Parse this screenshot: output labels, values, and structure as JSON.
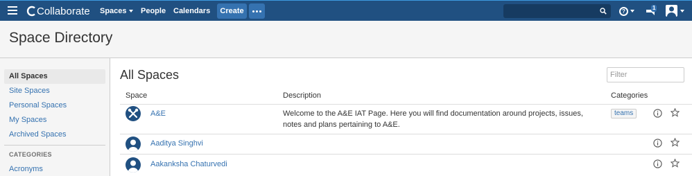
{
  "header": {
    "logo_text": "Collaborate",
    "nav": {
      "spaces": "Spaces",
      "people": "People",
      "calendars": "Calendars"
    },
    "create_label": "Create",
    "notification_count": "1",
    "icons": [
      "menu-icon",
      "logo-icon",
      "more-icon",
      "search-icon",
      "help-icon",
      "notification-icon",
      "user-avatar-icon"
    ],
    "colors": {
      "bar": "#205081",
      "button": "#3572b0"
    }
  },
  "page": {
    "title": "Space Directory"
  },
  "sidebar": {
    "items": [
      {
        "label": "All Spaces",
        "active": true
      },
      {
        "label": "Site Spaces"
      },
      {
        "label": "Personal Spaces"
      },
      {
        "label": "My Spaces"
      },
      {
        "label": "Archived Spaces"
      }
    ],
    "categories_heading": "CATEGORIES",
    "categories": [
      {
        "label": "Acronyms"
      }
    ]
  },
  "main": {
    "title": "All Spaces",
    "filter_placeholder": "Filter",
    "columns": {
      "space": "Space",
      "description": "Description",
      "categories": "Categories"
    },
    "rows": [
      {
        "name": "A&E",
        "description": "Welcome to the A&E IAT Page. Here you will find documentation around projects, issues, notes and plans pertaining to A&E.",
        "category": "teams",
        "icon": "tools-icon"
      },
      {
        "name": "Aaditya Singhvi",
        "description": "",
        "category": "",
        "icon": "person-avatar-icon"
      },
      {
        "name": "Aakanksha Chaturvedi",
        "description": "",
        "category": "",
        "icon": "person-avatar-icon"
      }
    ]
  }
}
